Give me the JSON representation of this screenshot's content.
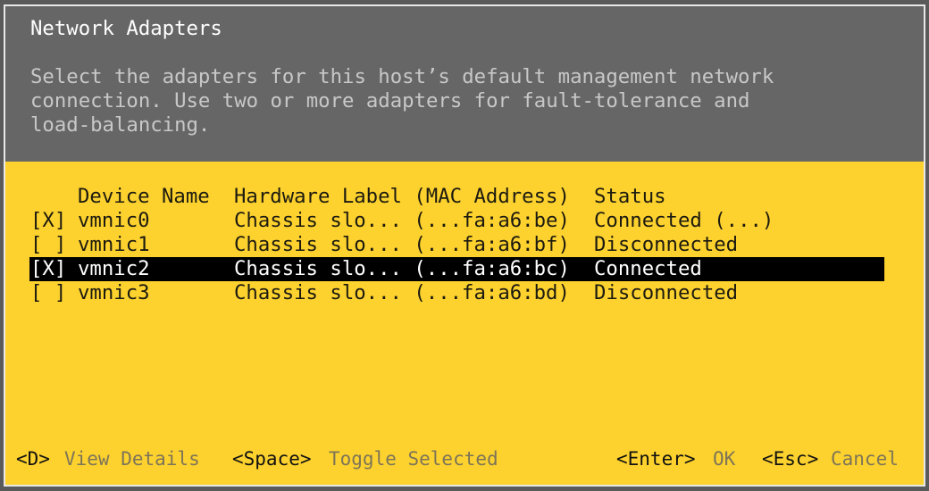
{
  "dialog": {
    "title": "Network Adapters",
    "description": [
      "Select the adapters for this host’s default management network",
      "connection. Use two or more adapters for fault-tolerance and",
      "load-balancing."
    ]
  },
  "table": {
    "columns": [
      "Device Name",
      "Hardware Label (MAC Address)",
      "Status"
    ],
    "rows": [
      {
        "checkbox": "[X]",
        "device": "vmnic0",
        "hardware": "Chassis slo... (...fa:a6:be)",
        "status": "Connected (...)",
        "selected": false
      },
      {
        "checkbox": "[ ]",
        "device": "vmnic1",
        "hardware": "Chassis slo... (...fa:a6:bf)",
        "status": "Disconnected",
        "selected": false
      },
      {
        "checkbox": "[X]",
        "device": "vmnic2",
        "hardware": "Chassis slo... (...fa:a6:bc)",
        "status": "Connected",
        "selected": true
      },
      {
        "checkbox": "[ ]",
        "device": "vmnic3",
        "hardware": "Chassis slo... (...fa:a6:bd)",
        "status": "Disconnected",
        "selected": false
      }
    ]
  },
  "footer": {
    "details_key": "<D>",
    "details_label": "View Details",
    "toggle_key": "<Space>",
    "toggle_label": "Toggle Selected",
    "ok_key": "<Enter>",
    "ok_label": "OK",
    "cancel_key": "<Esc>",
    "cancel_label": "Cancel"
  },
  "colors": {
    "header_bg": "#666666",
    "body_bg": "#fdd22e",
    "highlight": "#000000"
  }
}
